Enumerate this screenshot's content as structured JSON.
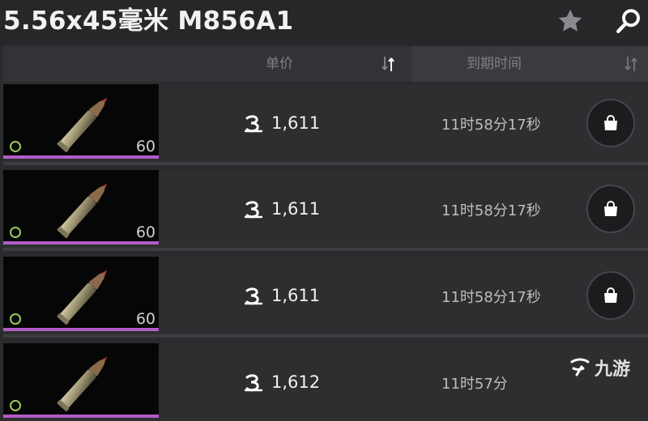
{
  "title": "5.56x45毫米 M856A1",
  "icons": {
    "favorite": "star-icon",
    "search": "search-icon",
    "currency": "coin-icon",
    "buy": "bag-icon",
    "sort": "sort-arrows-icon"
  },
  "columns": {
    "price": "单价",
    "expire": "到期时间"
  },
  "colors": {
    "rarity": "#b25cc7",
    "condition": "#9ac85e"
  },
  "listings": [
    {
      "qty": "60",
      "price": "1,611",
      "time": "11时58分17秒"
    },
    {
      "qty": "60",
      "price": "1,611",
      "time": "11时58分17秒"
    },
    {
      "qty": "60",
      "price": "1,611",
      "time": "11时58分17秒"
    },
    {
      "qty": "",
      "price": "1,612",
      "time": "11时57分"
    }
  ],
  "watermark": "九游"
}
